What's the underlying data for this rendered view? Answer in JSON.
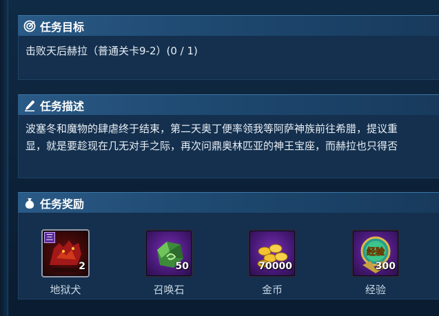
{
  "target": {
    "title": "任务目标",
    "text": "击败天后赫拉（普通关卡9-2）(0 / 1)"
  },
  "description": {
    "title": "任务描述",
    "line1": "波塞冬和魔物的肆虐终于结束，第二天奥丁便率领我等阿萨神族前往希腊，提议重",
    "line2": "显，就是要趁现在几无对手之际，再次问鼎奥林匹亚的神王宝座，而赫拉也只得否"
  },
  "rewards": {
    "title": "任务奖励",
    "items": [
      {
        "name": "地狱犬",
        "count": "2",
        "tier": "三",
        "icon": "hellhound-icon"
      },
      {
        "name": "召唤石",
        "count": "50",
        "icon": "summon-stone-icon"
      },
      {
        "name": "金币",
        "count": "70000",
        "icon": "gold-coins-icon"
      },
      {
        "name": "经验",
        "count": "300",
        "badge_text": "经验",
        "icon": "exp-badge-icon"
      }
    ]
  }
}
